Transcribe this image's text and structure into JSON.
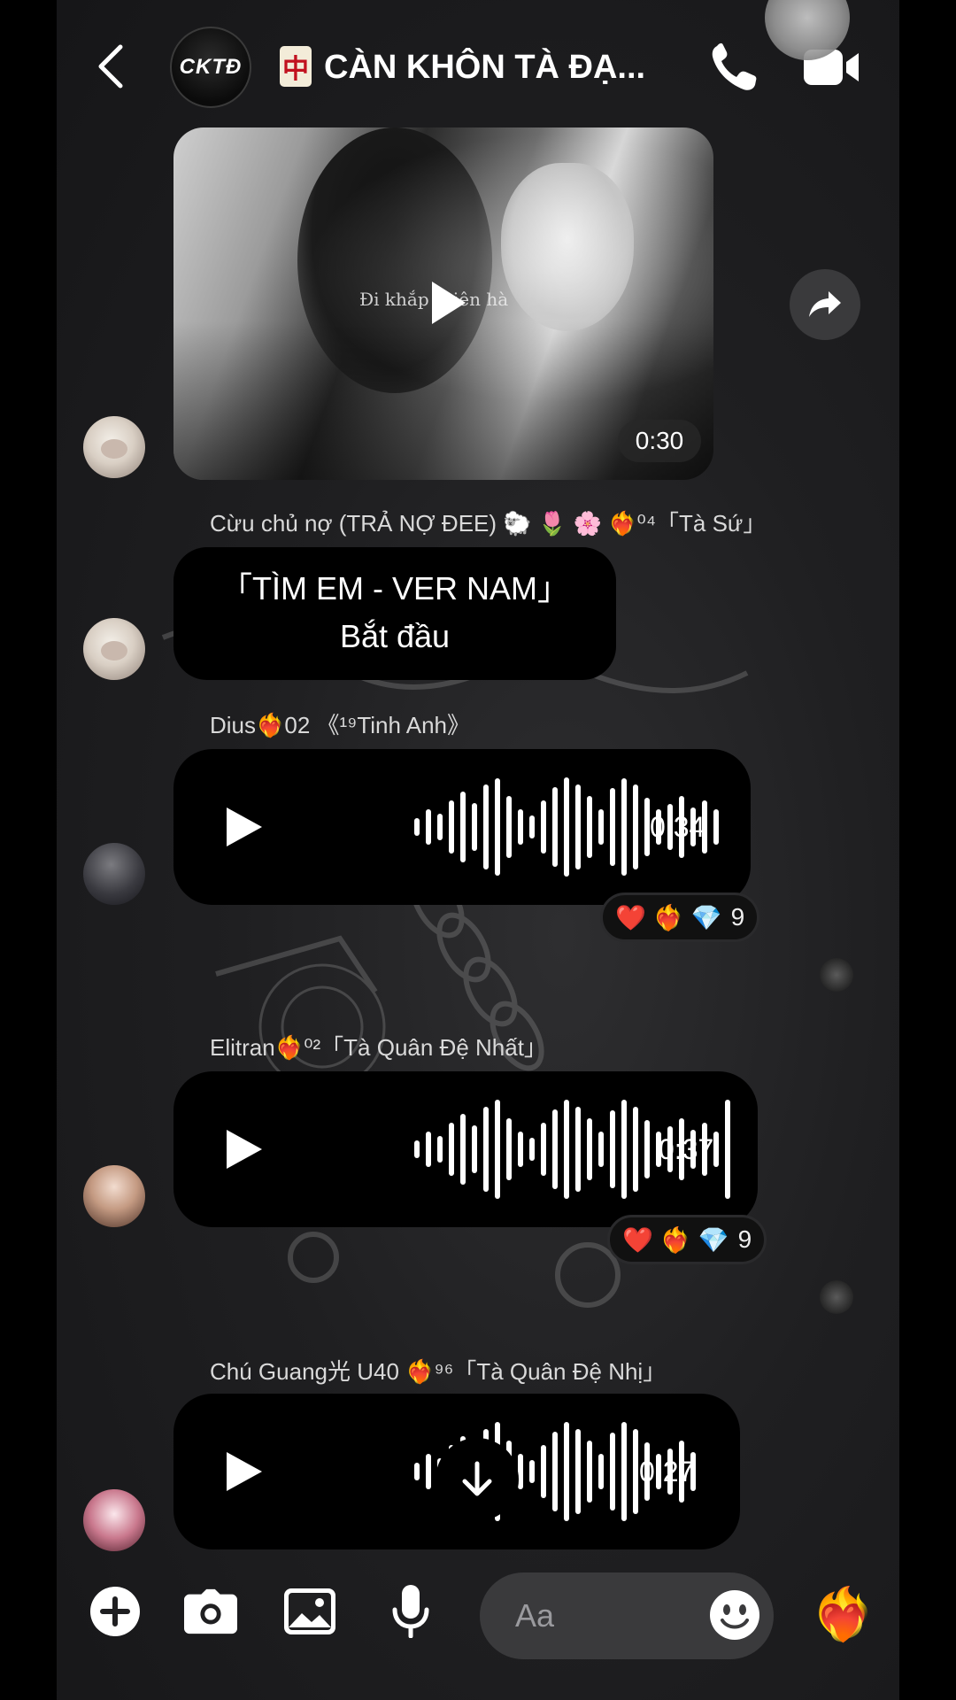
{
  "header": {
    "group_avatar_text": "CKTĐ",
    "title_emoji": "🀄",
    "title": "CÀN KHÔN TÀ ĐẠ..."
  },
  "messages": {
    "video": {
      "caption": "Đi khắp thiên hà",
      "duration": "0:30"
    },
    "text_msg": {
      "sender": "Cừu chủ nợ (TRẢ NỢ ĐEE) 🐑 🌷 🌸 ❤️‍🔥⁰⁴「Tà Sứ」",
      "line1": "「TÌM EM - VER NAM」",
      "line2": "Bắt đầu"
    },
    "voice1": {
      "sender": "Dius❤️‍🔥02 《¹⁹Tinh Anh》",
      "duration": "0:34",
      "reactions": [
        "❤️",
        "❤️‍🔥",
        "💎"
      ],
      "reaction_count": "9"
    },
    "voice2": {
      "sender": "Elitran❤️‍🔥⁰²「Tà Quân Đệ Nhất」",
      "duration": "0:37",
      "reactions": [
        "❤️",
        "❤️‍🔥",
        "💎"
      ],
      "reaction_count": "9"
    },
    "voice3": {
      "sender": "Chú Guang光 U40 ❤️‍🔥⁹⁶「Tà Quân Đệ Nhị」",
      "duration": "0:27"
    }
  },
  "composer": {
    "placeholder": "Aa",
    "like_emoji": "❤️‍🔥"
  },
  "icons": {
    "back": "chevron-left-icon",
    "call": "phone-icon",
    "video": "video-camera-icon",
    "share": "share-arrow-icon",
    "play": "play-icon",
    "scroll": "arrow-down-icon",
    "add": "plus-icon",
    "camera": "camera-icon",
    "gallery": "image-icon",
    "mic": "microphone-icon",
    "emoji": "smiley-icon"
  },
  "colors": {
    "background": "#1f1f21",
    "bubble": "#000000",
    "input": "#3a3a3c",
    "text": "#ffffff"
  }
}
